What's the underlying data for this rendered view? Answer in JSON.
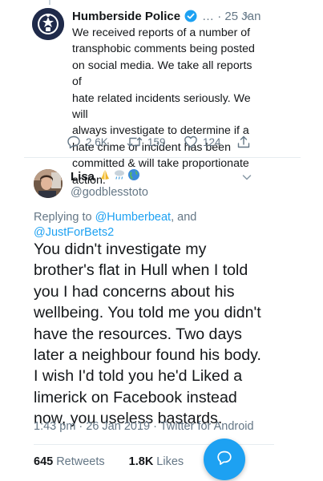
{
  "tweet1": {
    "author_name": "Humberside Police",
    "meta": "… · 25 Jan",
    "text": "We received reports of a number of\ntransphobic comments being posted\non social media. We take all reports of\nhate related incidents seriously. We will\nalways investigate to determine if a\nhate crime or incident has been\ncommitted & will take proportionate\naction.",
    "reply_count": "2.6K",
    "retweet_count": "159",
    "like_count": "124"
  },
  "tweet2": {
    "author_name": "Lisa",
    "author_emoji": [
      "folded-hands",
      "cloud-with-rain",
      "globe"
    ],
    "handle": "@godblesstoto",
    "replying_prefix": "Replying to ",
    "replying_to_1": "@Humberbeat",
    "replying_and": ", and",
    "replying_to_2": "@JustForBets2",
    "text": "You didn't investigate my\nbrother's flat in Hull when I told\nyou I had concerns about his\nwellbeing. You told me you didn't\nhave the resources. Two days\nlater a neighbour found his body.\nI wish I'd told you he'd Liked a\nlimerick on Facebook instead\nnow, you useless bastards.",
    "timestamp": "1:43 pm · 26 Jan 2019 · Twitter for Android",
    "retweets_count": "645",
    "retweets_label": "Retweets",
    "likes_count": "1.8K",
    "likes_label": "Likes"
  },
  "colors": {
    "accent": "#1da1f2",
    "text": "#14171a",
    "secondary_text": "#657786",
    "divider": "#e6ecf0"
  },
  "icons": {
    "verified": "verified-badge-icon",
    "more": "chevron-down-icon",
    "reply": "reply-icon",
    "retweet": "retweet-icon",
    "like": "heart-icon",
    "share": "share-icon",
    "compose": "compose-reply-icon"
  }
}
